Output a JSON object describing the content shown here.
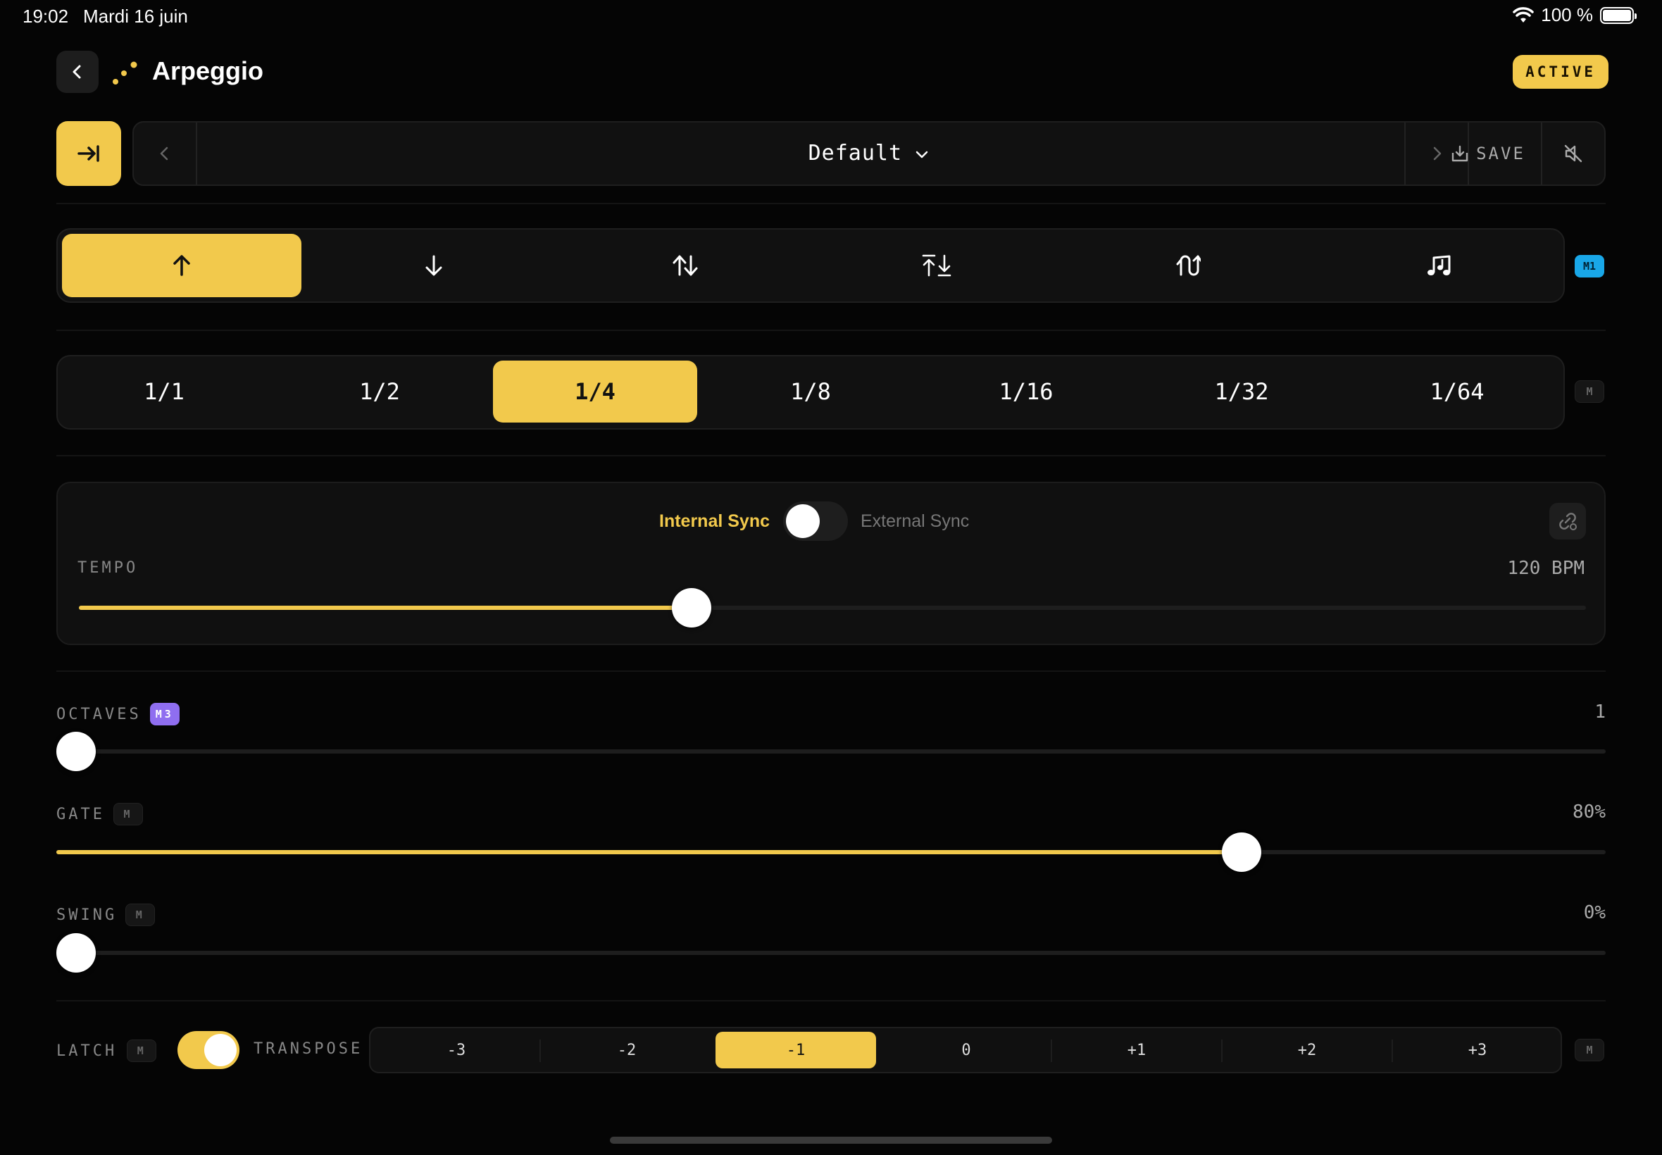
{
  "status_bar": {
    "time": "19:02",
    "date": "Mardi 16 juin",
    "battery": "100 %"
  },
  "header": {
    "title": "Arpeggio",
    "status": "ACTIVE"
  },
  "preset": {
    "name": "Default",
    "save_label": "SAVE"
  },
  "modes": {
    "items": [
      {
        "icon": "arrow-up-icon",
        "selected": true
      },
      {
        "icon": "arrow-down-icon",
        "selected": false
      },
      {
        "icon": "up-down-icon",
        "selected": false
      },
      {
        "icon": "converge-icon",
        "selected": false
      },
      {
        "icon": "random-order-icon",
        "selected": false
      },
      {
        "icon": "as-played-notes-icon",
        "selected": false
      }
    ],
    "tag": "M1"
  },
  "rate": {
    "items": [
      "1/1",
      "1/2",
      "1/4",
      "1/8",
      "1/16",
      "1/32",
      "1/64"
    ],
    "selected": "1/4",
    "tag": "M"
  },
  "sync": {
    "internal_label": "Internal Sync",
    "external_label": "External Sync",
    "external_enabled": false,
    "tempo_label": "TEMPO",
    "tempo_value": "120 BPM",
    "tempo_fraction": 0.404
  },
  "params": {
    "octaves": {
      "label": "OCTAVES",
      "tag": "M3",
      "value": "1",
      "fraction": 0.0
    },
    "gate": {
      "label": "GATE",
      "tag": "M",
      "value": "80%",
      "fraction": 0.772
    },
    "swing": {
      "label": "SWING",
      "tag": "M",
      "value": "0%",
      "fraction": 0.0
    }
  },
  "latch": {
    "label": "LATCH",
    "tag": "M",
    "enabled": true
  },
  "transpose": {
    "label": "TRANSPOSE",
    "items": [
      "-3",
      "-2",
      "-1",
      "0",
      "+1",
      "+2",
      "+3"
    ],
    "selected": "-1",
    "tag": "M"
  },
  "colors": {
    "accent": "#f2c94c",
    "tag_blue": "#19a7e8",
    "tag_purple": "#8f6ef0",
    "background": "#050505"
  }
}
